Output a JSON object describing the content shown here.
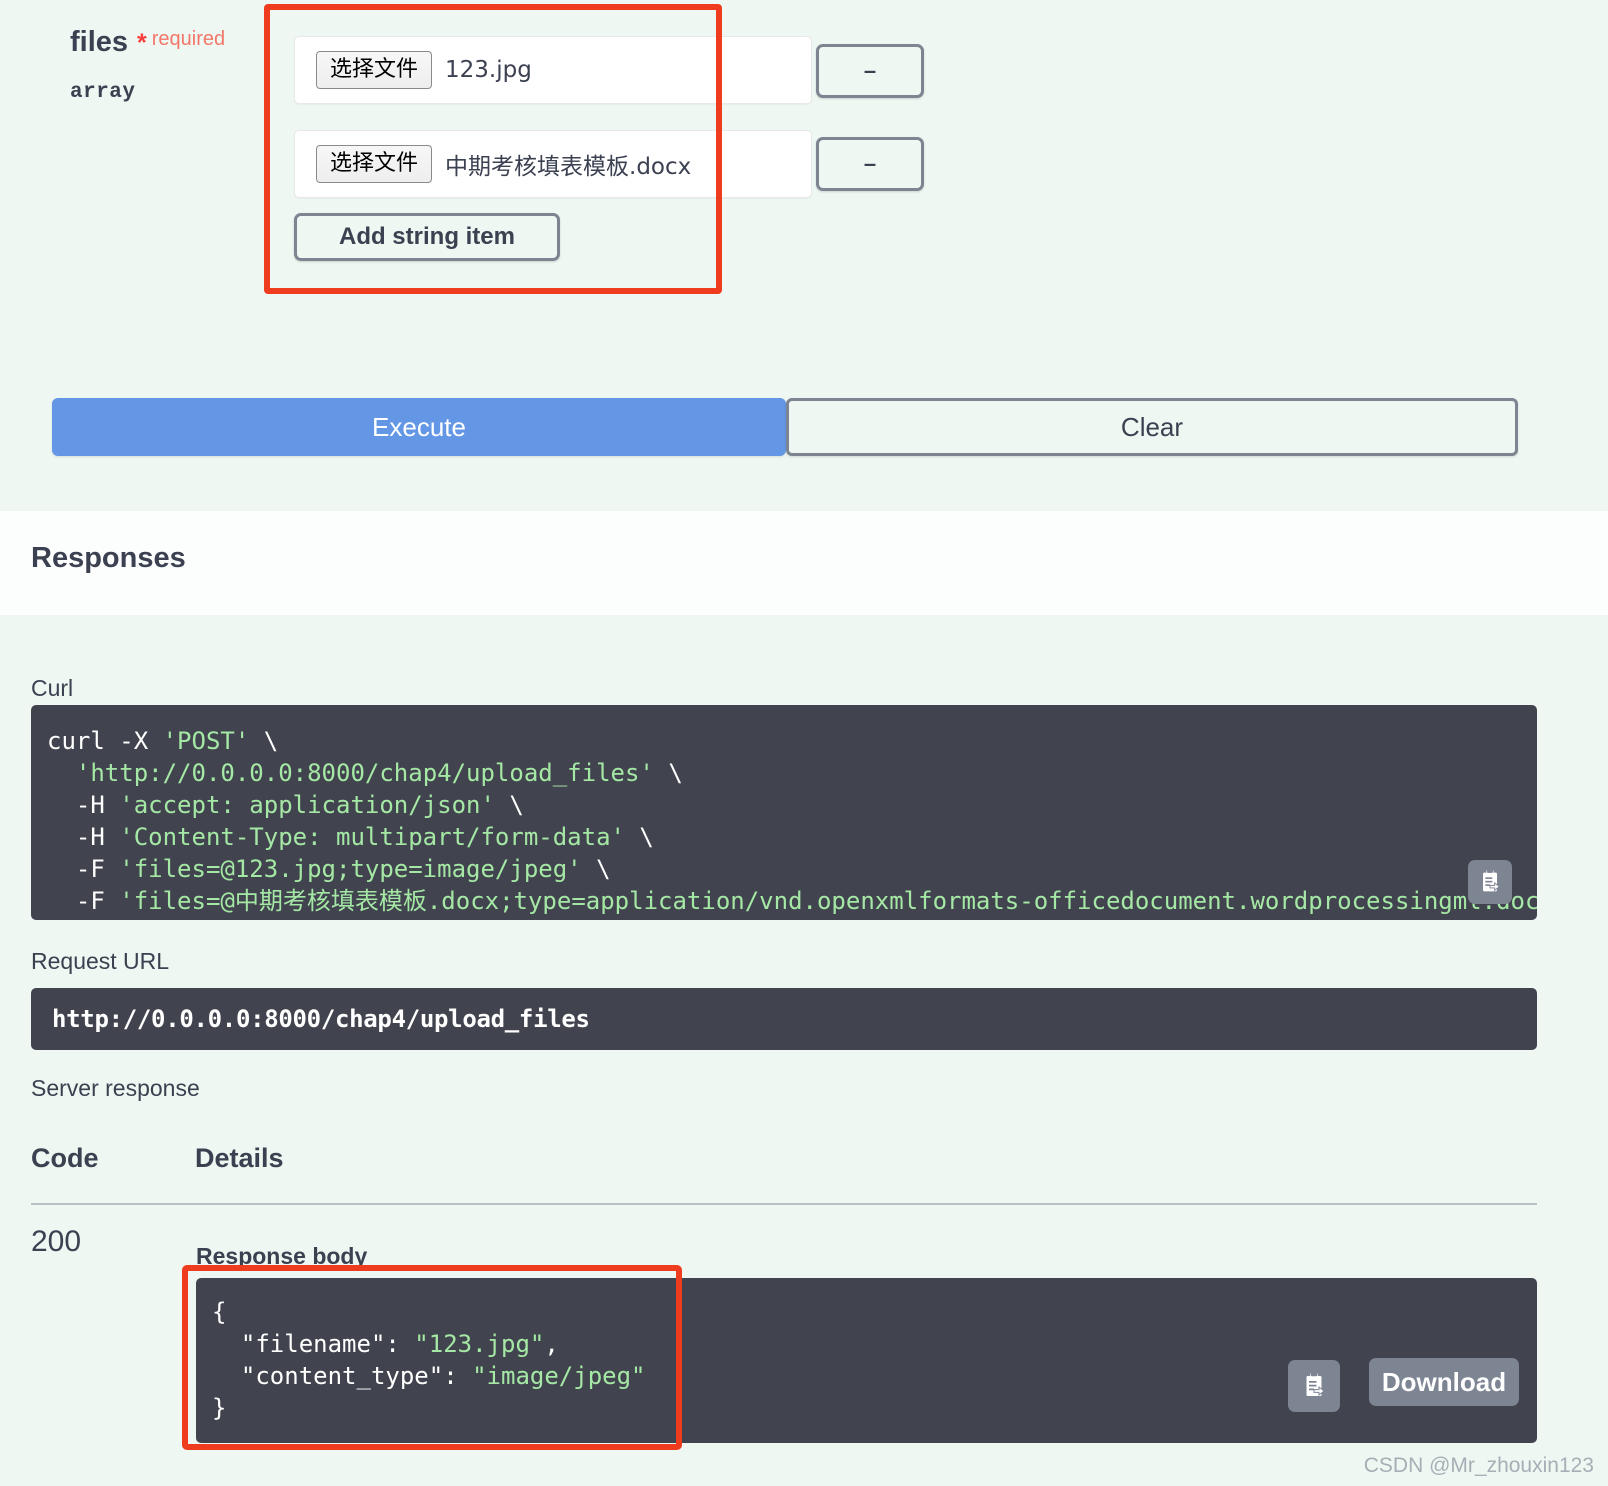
{
  "param": {
    "name": "files",
    "required_star": "*",
    "required_text": "required",
    "type": "array",
    "items": [
      {
        "choose_label": "选择文件",
        "filename": "123.jpg",
        "remove_label": "–"
      },
      {
        "choose_label": "选择文件",
        "filename": "中期考核填表模板.docx",
        "remove_label": "–"
      }
    ],
    "add_item_label": "Add string item"
  },
  "actions": {
    "execute_label": "Execute",
    "clear_label": "Clear"
  },
  "responses": {
    "title": "Responses",
    "curl_label": "Curl",
    "curl_lines": [
      {
        "segments": [
          {
            "t": "curl -X ",
            "c": "w"
          },
          {
            "t": "'POST'",
            "c": "g"
          },
          {
            "t": " \\",
            "c": "w"
          }
        ]
      },
      {
        "segments": [
          {
            "t": "  ",
            "c": "w"
          },
          {
            "t": "'http://0.0.0.0:8000/chap4/upload_files'",
            "c": "g"
          },
          {
            "t": " \\",
            "c": "w"
          }
        ]
      },
      {
        "segments": [
          {
            "t": "  -H ",
            "c": "w"
          },
          {
            "t": "'accept: application/json'",
            "c": "g"
          },
          {
            "t": " \\",
            "c": "w"
          }
        ]
      },
      {
        "segments": [
          {
            "t": "  -H ",
            "c": "w"
          },
          {
            "t": "'Content-Type: multipart/form-data'",
            "c": "g"
          },
          {
            "t": " \\",
            "c": "w"
          }
        ]
      },
      {
        "segments": [
          {
            "t": "  -F ",
            "c": "w"
          },
          {
            "t": "'files=@123.jpg;type=image/jpeg'",
            "c": "g"
          },
          {
            "t": " \\",
            "c": "w"
          }
        ]
      },
      {
        "segments": [
          {
            "t": "  -F ",
            "c": "w"
          },
          {
            "t": "'files=@中期考核填表模板.docx;type=application/vnd.openxmlformats-officedocument.wordprocessingml.document'",
            "c": "g"
          }
        ]
      }
    ],
    "request_url_label": "Request URL",
    "request_url": "http://0.0.0.0:8000/chap4/upload_files",
    "server_response_label": "Server response",
    "col_code": "Code",
    "col_details": "Details",
    "status_code": "200",
    "response_body_label": "Response body",
    "response_body_lines": [
      {
        "segments": [
          {
            "t": "{",
            "c": "w"
          }
        ]
      },
      {
        "segments": [
          {
            "t": "  \"filename\": ",
            "c": "w"
          },
          {
            "t": "\"123.jpg\"",
            "c": "g"
          },
          {
            "t": ",",
            "c": "w"
          }
        ]
      },
      {
        "segments": [
          {
            "t": "  \"content_type\": ",
            "c": "w"
          },
          {
            "t": "\"image/jpeg\"",
            "c": "g"
          }
        ]
      },
      {
        "segments": [
          {
            "t": "}",
            "c": "w"
          }
        ]
      }
    ],
    "download_label": "Download",
    "copy_icon": "copy-to-clipboard-icon"
  },
  "watermark": "CSDN @Mr_zhouxin123",
  "colors": {
    "band_bg": "#eef7f1",
    "code_bg": "#41444e",
    "accent_blue": "#6397e5",
    "highlight_red": "#f03c1e",
    "required_red": "#f93e3e",
    "code_green": "#a5e8a5",
    "button_gray": "#7d8492"
  }
}
